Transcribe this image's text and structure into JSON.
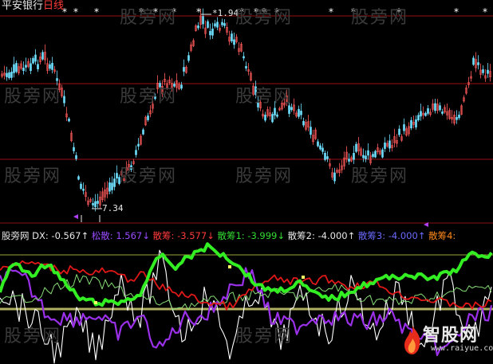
{
  "window": {
    "stock_name": "平安银行",
    "period": "日线",
    "stock_name_color": "#e8e8e8",
    "period_color": "#ff3b3b"
  },
  "price_panel": {
    "high_label": "1.94",
    "low_label": "7.34",
    "hint_marker": "*"
  },
  "indicator_panel": {
    "items": [
      {
        "label": "股旁网 DX:",
        "value": "-0.567",
        "arrow": "↑",
        "color": "#e8e8e8"
      },
      {
        "label": "松散:",
        "value": "1.567",
        "arrow": "↓",
        "color": "#9a4cff"
      },
      {
        "label": "散筹:",
        "value": "-3.577",
        "arrow": "↓",
        "color": "#ff3b3b"
      },
      {
        "label": "散筹1:",
        "value": "-3.999",
        "arrow": "↓",
        "color": "#33dd33"
      },
      {
        "label": "散筹2:",
        "value": "-4.000",
        "arrow": "↑",
        "color": "#e8e8e8"
      },
      {
        "label": "散筹3:",
        "value": "-4.000",
        "arrow": "↑",
        "color": "#6a6aff"
      },
      {
        "label": "散筹4:",
        "value": "",
        "arrow": "",
        "color": "#ff8a1c"
      }
    ]
  },
  "watermarks": [
    "股旁网",
    "股旁网",
    "股旁网",
    "股旁网",
    "股旁网",
    "股旁网",
    "股旁网",
    "股旁网",
    "股旁网",
    "股旁网",
    "股旁网",
    "股旁网"
  ],
  "logo": {
    "brand": "智股网",
    "url": "www.raiyue.com"
  },
  "colors": {
    "up_candle": "#ff5a5a",
    "down_candle": "#6fe0ff",
    "ref_line": "#9c1010",
    "line_white": "#ffffff",
    "line_purple": "#9a30e8",
    "line_red": "#e01818",
    "line_green": "#33ee22",
    "line_olive": "#b0b060",
    "line_lightgreen": "#88dd77"
  }
}
